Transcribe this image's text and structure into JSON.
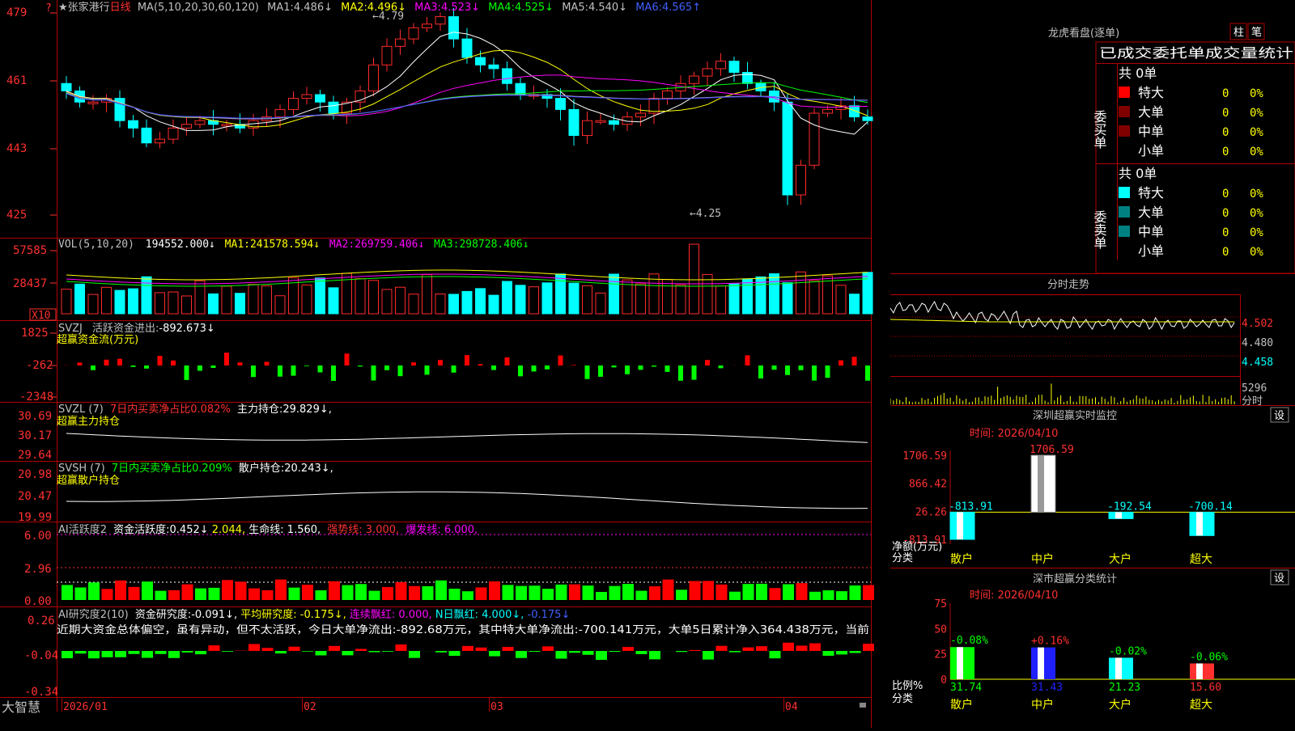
{
  "colors": {
    "up": "#ff2a2a",
    "down": "#00ffff",
    "frame": "#b00000",
    "ma1": "#ffffff",
    "ma2": "#ffff00",
    "ma3": "#ff00ff",
    "ma4": "#00ff00",
    "ma5": "#c0c0c0",
    "ma6": "#4040ff",
    "vol_ma1": "#ffff00",
    "vol_ma2": "#ff00ff",
    "vol_ma3": "#00ff00",
    "pos": "#ff0000",
    "neg": "#00ff00",
    "label": "#ffff00"
  },
  "price_panel": {
    "star": "★",
    "stock_name": "张家港行",
    "period": "日线",
    "ma_params": "MA(5,10,20,30,60,120)",
    "ma_values": [
      {
        "label": "MA1:",
        "value": "4.486↓"
      },
      {
        "label": "MA2:",
        "value": "4.496↓"
      },
      {
        "label": "MA3:",
        "value": "4.523↓"
      },
      {
        "label": "MA4:",
        "value": "4.525↓"
      },
      {
        "label": "MA5:",
        "value": "4.540↓"
      },
      {
        "label": "MA6:",
        "value": "4.565↑"
      }
    ],
    "y_ticks": [
      "479",
      "461",
      "443",
      "425"
    ],
    "high_label": "4.79",
    "low_label": "4.25",
    "question_mark": "?"
  },
  "vol_panel": {
    "header": "VOL(5,10,20)",
    "value": "194552.000↓",
    "ma": [
      {
        "label": "MA1:",
        "value": "241578.594↓"
      },
      {
        "label": "MA2:",
        "value": "269759.406↓"
      },
      {
        "label": "MA3:",
        "value": "298728.406↓"
      }
    ],
    "y_ticks": [
      "57585",
      "28437"
    ],
    "unit": "X10"
  },
  "svzj_panel": {
    "header": "SVZJ",
    "text": "活跃资金进出:",
    "value": "-892.673↓",
    "sub": "超赢资金流(万元)",
    "y_ticks": [
      "1825",
      "-262",
      "-2348"
    ]
  },
  "svzl_panel": {
    "header": "SVZL (7)",
    "ratio": "7日内买卖净占比0.082%",
    "text": "主力持仓:",
    "value": "29.829↓,",
    "sub": "超赢主力持仓",
    "y_ticks": [
      "30.69",
      "30.17",
      "29.64"
    ]
  },
  "svsh_panel": {
    "header": "SVSH (7)",
    "ratio": "7日内买卖净占比0.209%",
    "text": "散户持仓:",
    "value": "20.243↓,",
    "sub": "超赢散户持仓",
    "y_ticks": [
      "20.98",
      "20.47",
      "19.99"
    ]
  },
  "ai_panel": {
    "header": "AI活跃度2",
    "text": "资金活跃度:",
    "v1": "0.452↓",
    "v2": "2.044,",
    "life": "生命线: 1.560,",
    "strong": "强势线: 3.000,",
    "burst": "爆发线: 6.000,",
    "y_ticks": [
      "6.00",
      "2.96",
      "0.00"
    ]
  },
  "ai2_panel": {
    "header": "AI研究度2(10)",
    "text": "资金研究度:",
    "v1": "-0.091↓,",
    "avg": "平均研究度: -0.175↓,",
    "red": "连续飘红: 0.000,",
    "nred": "N日飘红: 4.000↓,",
    "v5": "-0.175↓",
    "comment": "近期大资金总体偏空，虽有异动，但不太活跃，今日大单净流出:-892.68万元，其中特大单净流出:-700.141万元，大单5日累计净入364.438万元，当前",
    "y_ticks": [
      "0.26",
      "-0.04",
      "-0.34"
    ]
  },
  "x_axis": {
    "brand": "大智慧",
    "labels": [
      "2026/01",
      "02",
      "03",
      "04"
    ]
  },
  "lhb": {
    "title": "龙虎看盘(逐单)",
    "btn1": "柱",
    "btn2": "笔",
    "tab_title": "已成交委托单成交量统计",
    "buy": {
      "side_label": "委买单",
      "total": "共 0单",
      "rows": [
        {
          "name": "特大",
          "count": "0",
          "pct": "0%",
          "color": "#ff0000"
        },
        {
          "name": "大单",
          "count": "0",
          "pct": "0%",
          "color": "#800000"
        },
        {
          "name": "中单",
          "count": "0",
          "pct": "0%",
          "color": "#800000"
        },
        {
          "name": "小单",
          "count": "0",
          "pct": "0%",
          "color": ""
        }
      ]
    },
    "sell": {
      "side_label": "委卖单",
      "total": "共 0单",
      "rows": [
        {
          "name": "特大",
          "count": "0",
          "pct": "0%",
          "color": "#00ffff"
        },
        {
          "name": "大单",
          "count": "0",
          "pct": "0%",
          "color": "#008080"
        },
        {
          "name": "中单",
          "count": "0",
          "pct": "0%",
          "color": "#008080"
        },
        {
          "name": "小单",
          "count": "0",
          "pct": "0%",
          "color": ""
        }
      ]
    }
  },
  "intraday": {
    "title": "分时走势",
    "prices": [
      "4.502",
      "4.480",
      "4.458"
    ],
    "vol": "5296",
    "vol_unit": "分时"
  },
  "sz_monitor": {
    "title": "深圳超赢实时监控",
    "setting": "设",
    "time": "时间: 2026/04/10",
    "y_ticks": [
      "1706.59",
      "866.42",
      "26.26",
      "-813.91"
    ],
    "axis_label1": "净额(万元)",
    "axis_label2": "分类",
    "bars": [
      {
        "cat": "散户",
        "value": -813.91,
        "label": "-813.91"
      },
      {
        "cat": "中户",
        "value": 1706.59,
        "label": "1706.59"
      },
      {
        "cat": "大户",
        "value": -192.54,
        "label": "-192.54"
      },
      {
        "cat": "超大",
        "value": -700.14,
        "label": "-700.14"
      }
    ]
  },
  "sz_class": {
    "title": "深市超赢分类统计",
    "setting": "设",
    "time": "时间: 2026/04/10",
    "y_ticks": [
      "75",
      "50",
      "25",
      "0"
    ],
    "axis_label1": "比例%",
    "axis_label2": "分类",
    "bars": [
      {
        "cat": "散户",
        "value": 31.74,
        "change": "-0.08%"
      },
      {
        "cat": "中户",
        "value": 31.43,
        "change": "+0.16%"
      },
      {
        "cat": "大户",
        "value": 21.23,
        "change": "-0.02%"
      },
      {
        "cat": "超大",
        "value": 15.6,
        "change": "-0.06%"
      }
    ]
  }
}
